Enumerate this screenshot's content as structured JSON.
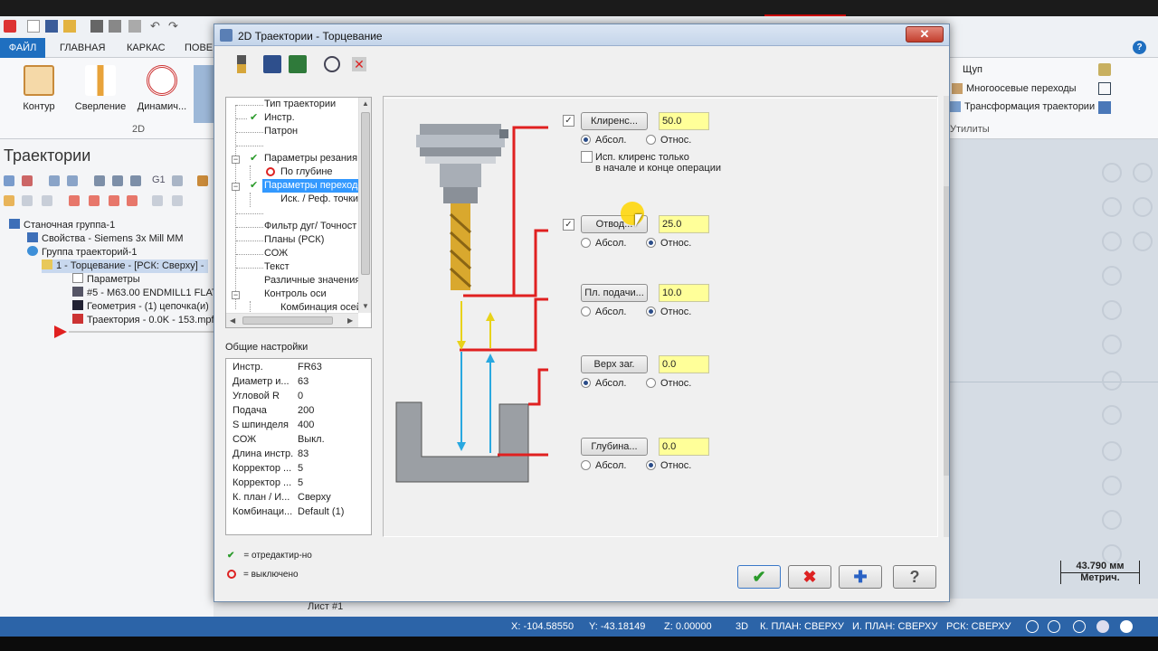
{
  "ribbon": {
    "tabs": [
      "ФАЙЛ",
      "ГЛАВНАЯ",
      "КАРКАС",
      "ПОВЕ"
    ],
    "buttons": [
      "Контур",
      "Сверление",
      "Динамич..."
    ],
    "group_label": "2D",
    "right_items": [
      "Щуп",
      "Многоосевые переходы",
      "Трансформация траектории"
    ],
    "right_group_label": "Утилиты"
  },
  "left_panel": {
    "title": "Траектории",
    "tree": [
      "Станочная группа-1",
      "Свойства - Siemens 3x Mill MM",
      "Группа траекторий-1",
      "1 - Торцевание - [РСК: Сверху] -",
      "Параметры",
      "#5 - M63.00 ENDMILL1 FLAT -",
      "Геометрия -  (1) цепочка(и)",
      "Траектория - 0.0K - 153.mpf"
    ]
  },
  "dialog": {
    "title": "2D Траектории - Торцевание",
    "close": "✕",
    "options_tree": [
      "Тип траектории",
      "Инстр.",
      "Патрон",
      "Параметры резания",
      "По глубине",
      "Параметры переходо",
      "Иск. / Реф. точки",
      "Фильтр дуг/ Точност",
      "Планы (РСК)",
      "СОЖ",
      "Текст",
      "Различные значения",
      "Контроль оси",
      "Комбинация осей"
    ],
    "general_label": "Общие настройки",
    "general": [
      {
        "k": "Инстр.",
        "v": "FR63"
      },
      {
        "k": "Диаметр и...",
        "v": "63"
      },
      {
        "k": "Угловой R",
        "v": "0"
      },
      {
        "k": "Подача",
        "v": "200"
      },
      {
        "k": "S шпинделя",
        "v": "400"
      },
      {
        "k": "СОЖ",
        "v": "Выкл."
      },
      {
        "k": "Длина инстр.",
        "v": "83"
      },
      {
        "k": "Корректор ...",
        "v": "5"
      },
      {
        "k": "Корректор ...",
        "v": "5"
      },
      {
        "k": "К. план / И...",
        "v": "Сверху"
      },
      {
        "k": "Комбинаци...",
        "v": "Default (1)"
      }
    ],
    "legend_edited": "= отредактир-но",
    "legend_disabled": "= выключено",
    "params": [
      {
        "button": "Кли­ренс...",
        "value": "50.0",
        "abs": "Абсол.",
        "rel": "Относ.",
        "selected": "abs",
        "checkbox": true
      },
      {
        "button": "Отвод...",
        "value": "25.0",
        "abs": "Абсол.",
        "rel": "Относ.",
        "selected": "rel",
        "checkbox": true
      },
      {
        "button": "Пл. подачи...",
        "value": "10.0",
        "abs": "Абсол.",
        "rel": "Относ.",
        "selected": "rel",
        "checkbox": false
      },
      {
        "button": "Верх заг.",
        "value": "0.0",
        "abs": "Абсол.",
        "rel": "Относ.",
        "selected": "abs",
        "checkbox": false
      },
      {
        "button": "Глубина...",
        "value": "0.0",
        "abs": "Абсол.",
        "rel": "Относ.",
        "selected": "rel",
        "checkbox": false
      }
    ],
    "clearance_note_line1": "Исп. кли­ренс только",
    "clearance_note_line2": "в начале и конце операции",
    "ok": "✔",
    "cancel": "✖",
    "apply": "✚",
    "help": "?"
  },
  "viewport": {
    "scale_value": "43.790 мм",
    "scale_unit": "Метрич."
  },
  "sheet_tab": "Лист #1",
  "status": {
    "x": "X:   -104.58550",
    "y": "Y:   -43.18149",
    "z": "Z:   0.00000",
    "mode": "3D",
    "kplan": "К. ПЛАН: СВЕРХУ",
    "iplan": "И. ПЛАН: СВЕРХУ",
    "rsk": "РСК: СВЕРХУ"
  },
  "colors": {
    "accent": "#1f6fc0",
    "status_bar": "#2c64a8",
    "input_highlight": "#ffff99",
    "diagram_red": "#e02020",
    "diagram_cyan": "#29a8e0",
    "diagram_yellow": "#e8d21a"
  }
}
